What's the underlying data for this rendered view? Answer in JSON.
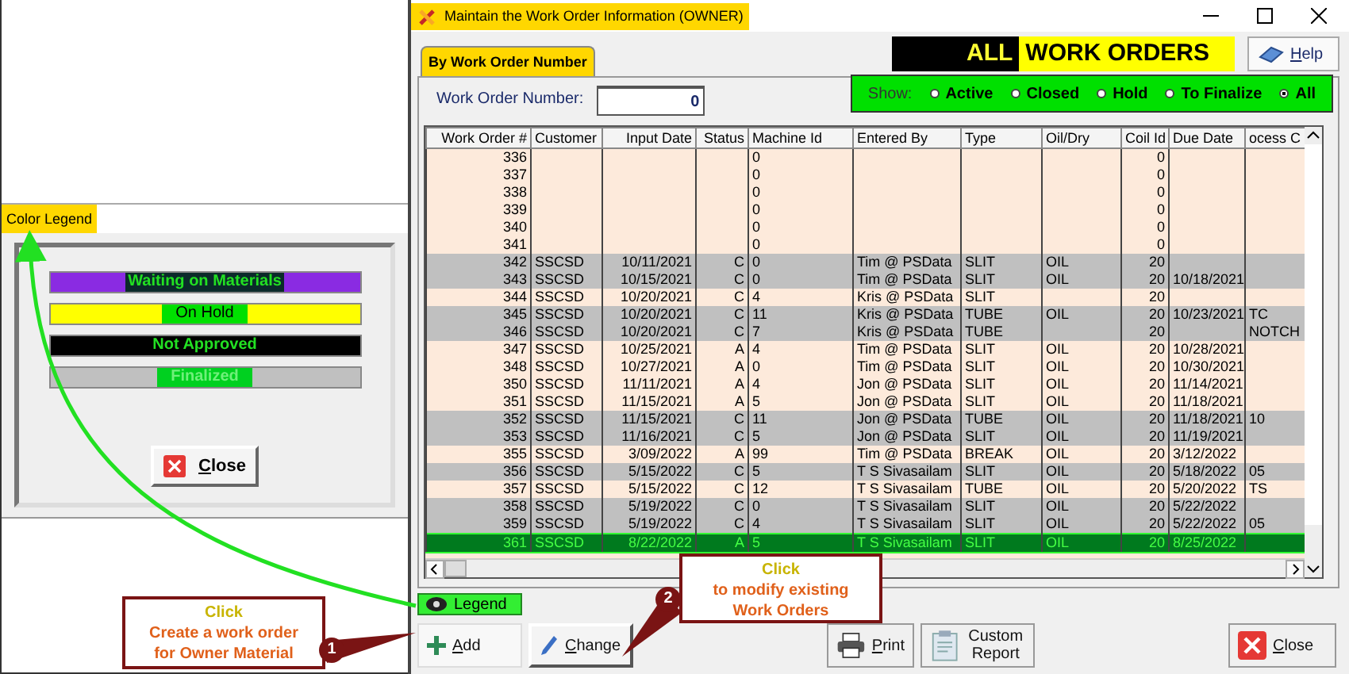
{
  "legend_dialog": {
    "title": "Color Legend",
    "items": [
      {
        "label": "Waiting on Materials",
        "color": "#8a2be2",
        "kind": "dark"
      },
      {
        "label": "On Hold",
        "color": "#ffff00",
        "kind": "green"
      },
      {
        "label": "Not Approved",
        "color": "#000000",
        "kind": "plain"
      },
      {
        "label": "Finalized",
        "color": "#c0c0c0",
        "kind": "faded"
      }
    ],
    "close_button": "Close"
  },
  "window": {
    "title": "Maintain the Work Order Information (OWNER)"
  },
  "banner": {
    "lead": "ALL",
    "title": "WORK ORDERS"
  },
  "help_button": "Help",
  "tabs": [
    {
      "label": "By Work Order Number",
      "selected": true
    }
  ],
  "work_order_field": {
    "label": "Work Order Number:",
    "value": "0"
  },
  "show_filter": {
    "label": "Show:",
    "options": [
      {
        "label": "Active",
        "selected": false
      },
      {
        "label": "Closed",
        "selected": false
      },
      {
        "label": "Hold",
        "selected": false
      },
      {
        "label": "To Finalize",
        "selected": false
      },
      {
        "label": "All",
        "selected": true
      }
    ]
  },
  "table": {
    "columns": [
      "Work Order #",
      "Customer",
      "Input Date",
      "Status",
      "Machine Id",
      "Entered By",
      "Type",
      "Oil/Dry",
      "Coil Id",
      "Due Date",
      "ocess C"
    ],
    "rows": [
      {
        "cells": [
          "336",
          "",
          "",
          "",
          "0",
          "",
          "",
          "",
          "0",
          "",
          ""
        ],
        "color": "#fdeadb",
        "selected": false
      },
      {
        "cells": [
          "337",
          "",
          "",
          "",
          "0",
          "",
          "",
          "",
          "0",
          "",
          ""
        ],
        "color": "#fdeadb",
        "selected": false
      },
      {
        "cells": [
          "338",
          "",
          "",
          "",
          "0",
          "",
          "",
          "",
          "0",
          "",
          ""
        ],
        "color": "#fdeadb",
        "selected": false
      },
      {
        "cells": [
          "339",
          "",
          "",
          "",
          "0",
          "",
          "",
          "",
          "0",
          "",
          ""
        ],
        "color": "#fdeadb",
        "selected": false
      },
      {
        "cells": [
          "340",
          "",
          "",
          "",
          "0",
          "",
          "",
          "",
          "0",
          "",
          ""
        ],
        "color": "#fdeadb",
        "selected": false
      },
      {
        "cells": [
          "341",
          "",
          "",
          "",
          "0",
          "",
          "",
          "",
          "0",
          "",
          ""
        ],
        "color": "#fdeadb",
        "selected": false
      },
      {
        "cells": [
          "342",
          "SSCSD",
          "10/11/2021",
          "C",
          "0",
          "Tim @ PSData",
          "SLIT",
          "OIL",
          "20",
          "",
          ""
        ],
        "color": "#c0c0c0",
        "selected": false
      },
      {
        "cells": [
          "343",
          "SSCSD",
          "10/15/2021",
          "C",
          "0",
          "Tim @ PSData",
          "SLIT",
          "OIL",
          "20",
          "10/18/2021",
          ""
        ],
        "color": "#c0c0c0",
        "selected": false
      },
      {
        "cells": [
          "344",
          "SSCSD",
          "10/20/2021",
          "C",
          "4",
          "Kris @ PSData",
          "SLIT",
          "",
          "20",
          "",
          ""
        ],
        "color": "#fdeadb",
        "selected": false
      },
      {
        "cells": [
          "345",
          "SSCSD",
          "10/20/2021",
          "C",
          "11",
          "Kris @ PSData",
          "TUBE",
          "OIL",
          "20",
          "10/23/2021",
          "TC"
        ],
        "color": "#c0c0c0",
        "selected": false
      },
      {
        "cells": [
          "346",
          "SSCSD",
          "10/20/2021",
          "C",
          "7",
          "Kris @ PSData",
          "TUBE",
          "",
          "20",
          "",
          "NOTCH"
        ],
        "color": "#c0c0c0",
        "selected": false
      },
      {
        "cells": [
          "347",
          "SSCSD",
          "10/25/2021",
          "A",
          "4",
          "Tim @ PSData",
          "SLIT",
          "OIL",
          "20",
          "10/28/2021",
          ""
        ],
        "color": "#fdeadb",
        "selected": false
      },
      {
        "cells": [
          "348",
          "SSCSD",
          "10/27/2021",
          "A",
          "0",
          "Tim @ PSData",
          "SLIT",
          "OIL",
          "20",
          "10/30/2021",
          ""
        ],
        "color": "#fdeadb",
        "selected": false
      },
      {
        "cells": [
          "350",
          "SSCSD",
          "11/11/2021",
          "A",
          "4",
          "Jon @ PSData",
          "SLIT",
          "OIL",
          "20",
          "11/14/2021",
          ""
        ],
        "color": "#fdeadb",
        "selected": false
      },
      {
        "cells": [
          "351",
          "SSCSD",
          "11/15/2021",
          "A",
          "5",
          "Jon @ PSData",
          "SLIT",
          "OIL",
          "20",
          "11/18/2021",
          ""
        ],
        "color": "#fdeadb",
        "selected": false
      },
      {
        "cells": [
          "352",
          "SSCSD",
          "11/15/2021",
          "C",
          "11",
          "Jon @ PSData",
          "TUBE",
          "OIL",
          "20",
          "11/18/2021",
          "10"
        ],
        "color": "#c0c0c0",
        "selected": false
      },
      {
        "cells": [
          "353",
          "SSCSD",
          "11/16/2021",
          "C",
          "5",
          "Jon @ PSData",
          "SLIT",
          "OIL",
          "20",
          "11/19/2021",
          ""
        ],
        "color": "#c0c0c0",
        "selected": false
      },
      {
        "cells": [
          "355",
          "SSCSD",
          "3/09/2022",
          "A",
          "99",
          "Tim @ PSData",
          "BREAK",
          "OIL",
          "20",
          "3/12/2022",
          ""
        ],
        "color": "#fdeadb",
        "selected": false
      },
      {
        "cells": [
          "356",
          "SSCSD",
          "5/15/2022",
          "C",
          "5",
          "T S Sivasailam",
          "SLIT",
          "OIL",
          "20",
          "5/18/2022",
          "05"
        ],
        "color": "#c0c0c0",
        "selected": false
      },
      {
        "cells": [
          "357",
          "SSCSD",
          "5/15/2022",
          "C",
          "12",
          "T S Sivasailam",
          "TUBE",
          "OIL",
          "20",
          "5/20/2022",
          "TS"
        ],
        "color": "#fdeadb",
        "selected": false
      },
      {
        "cells": [
          "358",
          "SSCSD",
          "5/19/2022",
          "C",
          "0",
          "T S Sivasailam",
          "SLIT",
          "OIL",
          "20",
          "5/22/2022",
          ""
        ],
        "color": "#c0c0c0",
        "selected": false
      },
      {
        "cells": [
          "359",
          "SSCSD",
          "5/19/2022",
          "C",
          "4",
          "T S Sivasailam",
          "SLIT",
          "OIL",
          "20",
          "5/22/2022",
          "05"
        ],
        "color": "#c0c0c0",
        "selected": false
      },
      {
        "cells": [
          "361",
          "SSCSD",
          "8/22/2022",
          "A",
          "5",
          "T S Sivasailam",
          "SLIT",
          "OIL",
          "20",
          "8/25/2022",
          ""
        ],
        "selected": true
      }
    ]
  },
  "legend_button": "Legend",
  "toolbar": [
    {
      "label": "Add",
      "kind": "add"
    },
    {
      "label": "Change",
      "kind": "change"
    },
    {
      "label": "Print",
      "kind": "print"
    },
    {
      "label": "Custom Report",
      "kind": "report"
    },
    {
      "label": "Close",
      "kind": "close"
    }
  ],
  "callouts": [
    {
      "badge": "1",
      "lines": [
        {
          "text": "Click",
          "color": "#c8b400"
        },
        {
          "text": "Create a work order",
          "color": "#e0601a"
        },
        {
          "text": "for Owner Material",
          "color": "#e0601a"
        }
      ]
    },
    {
      "badge": "2",
      "lines": [
        {
          "text": "Click",
          "color": "#c8b400"
        },
        {
          "text": "to modify existing",
          "color": "#e0601a"
        },
        {
          "text": "Work Orders",
          "color": "#e0601a"
        }
      ]
    }
  ]
}
